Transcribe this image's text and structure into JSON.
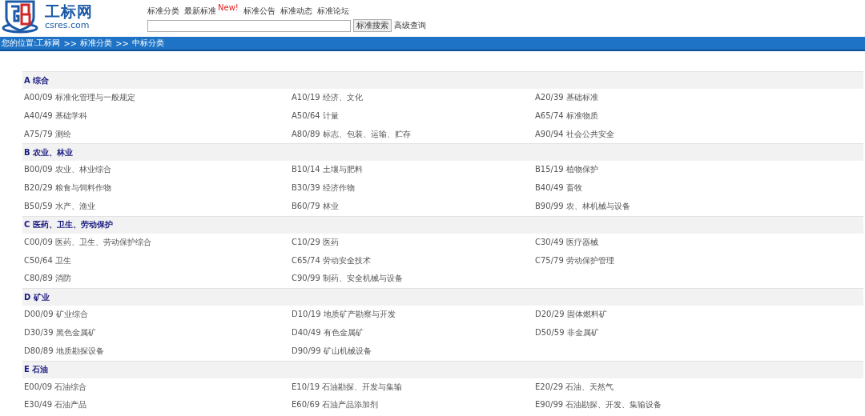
{
  "logo": {
    "name": "工标网",
    "domain": "csres.com"
  },
  "nav": [
    {
      "label": "标准分类"
    },
    {
      "label": "最新标准",
      "badge": "New!"
    },
    {
      "label": "标准公告"
    },
    {
      "label": "标准动态"
    },
    {
      "label": "标准论坛"
    }
  ],
  "search": {
    "button": "标准搜索",
    "advanced": "高级查询"
  },
  "breadcrumb": [
    "您的位置:工标网",
    ">>",
    "标准分类",
    ">>",
    "中标分类"
  ],
  "sections": [
    {
      "title": "A 综合",
      "items": [
        "A00/09 标准化管理与一般规定",
        "A10/19 经济、文化",
        "A20/39 基础标准",
        "A40/49 基础学科",
        "A50/64 计量",
        "A65/74 标准物质",
        "A75/79 测绘",
        "A80/89 标志、包装、运输、贮存",
        "A90/94 社会公共安全"
      ]
    },
    {
      "title": "B 农业、林业",
      "items": [
        "B00/09 农业、林业综合",
        "B10/14 土壤与肥料",
        "B15/19 植物保护",
        "B20/29 粮食与饲料作物",
        "B30/39 经济作物",
        "B40/49 畜牧",
        "B50/59 水产、渔业",
        "B60/79 林业",
        "B90/99 农、林机械与设备"
      ]
    },
    {
      "title": "C 医药、卫生、劳动保护",
      "items": [
        "C00/09 医药、卫生、劳动保护综合",
        "C10/29 医药",
        "C30/49 医疗器械",
        "C50/64 卫生",
        "C65/74 劳动安全技术",
        "C75/79 劳动保护管理",
        "C80/89 消防",
        "C90/99 制药、安全机械与设备"
      ]
    },
    {
      "title": "D 矿业",
      "items": [
        "D00/09 矿业综合",
        "D10/19 地质矿产勘察与开发",
        "D20/29 固体燃料矿",
        "D30/39 黑色金属矿",
        "D40/49 有色金属矿",
        "D50/59 非金属矿",
        "D80/89 地质勘探设备",
        "D90/99 矿山机械设备"
      ]
    },
    {
      "title": "E 石油",
      "items": [
        "E00/09 石油综合",
        "E10/19 石油勘探、开发与集输",
        "E20/29 石油、天然气",
        "E30/49 石油产品",
        "E60/69 石油产品添加剂",
        "E90/99 石油勘探、开发、集输设备"
      ]
    }
  ]
}
